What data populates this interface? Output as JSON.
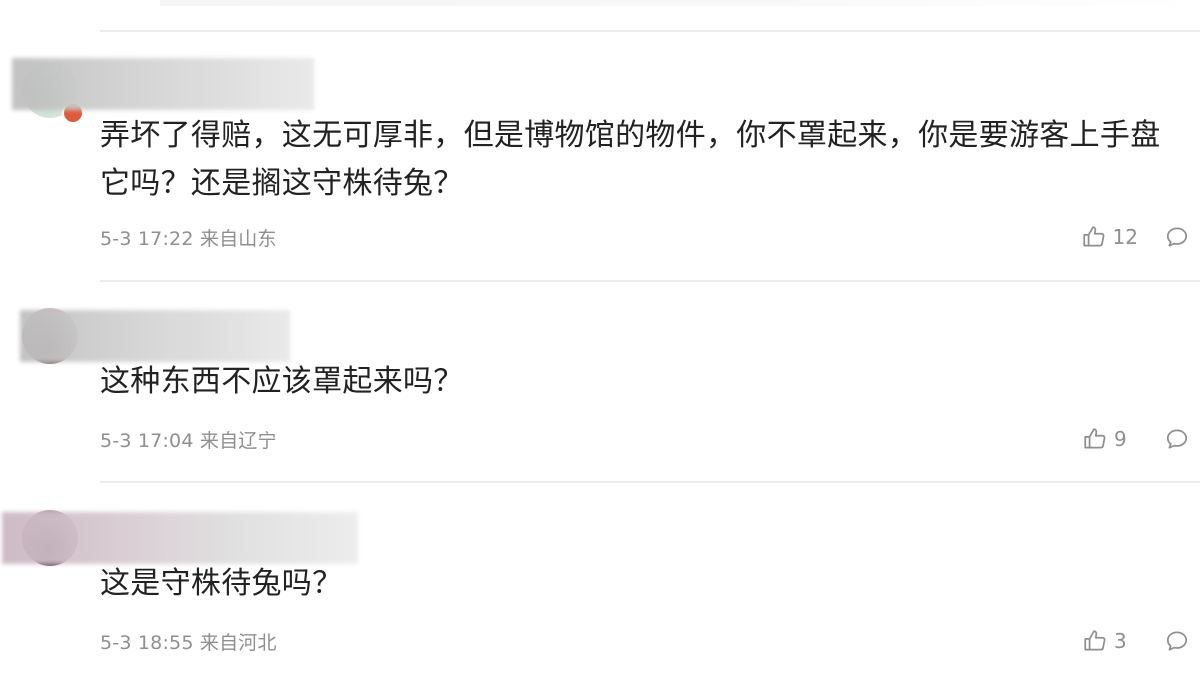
{
  "comments": [
    {
      "text": "弄坏了得赔，这无可厚非，但是博物馆的物件，你不罩起来，你是要游客上手盘它吗？还是搁这守株待兔？",
      "date": "5-3 17:22",
      "location": "来自山东",
      "likes": "12"
    },
    {
      "text": "这种东西不应该罩起来吗？",
      "date": "5-3 17:04",
      "location": "来自辽宁",
      "likes": "9"
    },
    {
      "text": "这是守株待兔吗？",
      "date": "5-3 18:55",
      "location": "来自河北",
      "likes": "3"
    }
  ],
  "icons": {
    "like": "thumbs-up-icon",
    "reply": "comment-bubble-icon"
  },
  "colors": {
    "meta_text": "#8f8f8f",
    "body_text": "#222222",
    "divider": "#ececec"
  }
}
